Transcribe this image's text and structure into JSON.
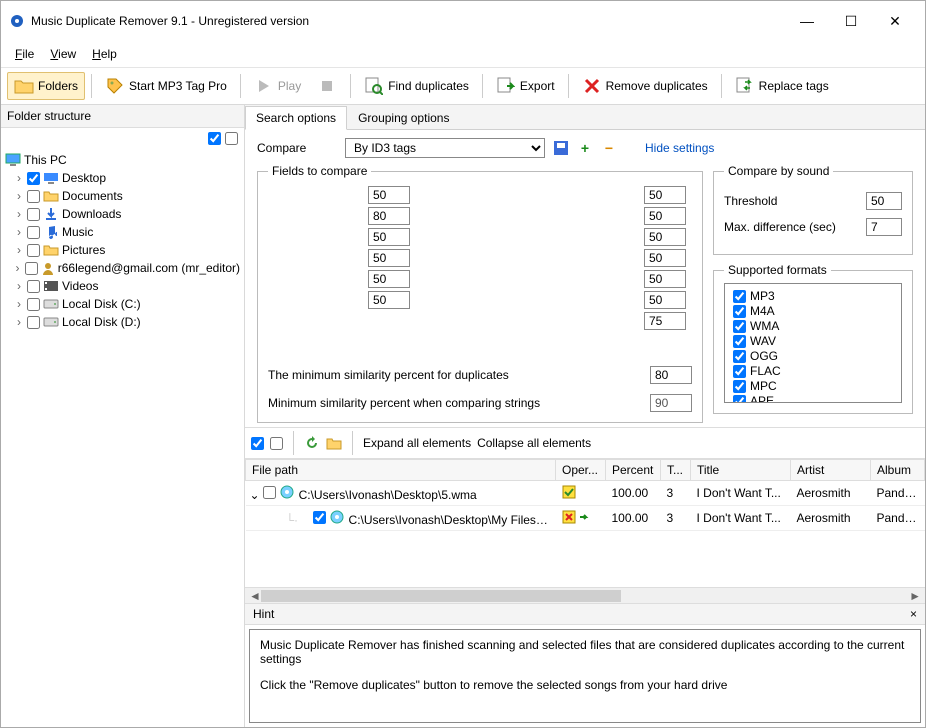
{
  "window": {
    "title": "Music Duplicate Remover 9.1 - Unregistered version"
  },
  "menu": {
    "file": "File",
    "view": "View",
    "help": "Help"
  },
  "toolbar": {
    "folders": "Folders",
    "start_tag": "Start MP3 Tag Pro",
    "play": "Play",
    "find_dup": "Find duplicates",
    "export": "Export",
    "remove_dup": "Remove duplicates",
    "replace_tags": "Replace tags"
  },
  "left": {
    "title": "Folder structure",
    "root": "This PC",
    "items": [
      {
        "label": "Desktop",
        "checked": true,
        "icon": "desktop"
      },
      {
        "label": "Documents",
        "checked": false,
        "icon": "folder"
      },
      {
        "label": "Downloads",
        "checked": false,
        "icon": "download"
      },
      {
        "label": "Music",
        "checked": false,
        "icon": "music"
      },
      {
        "label": "Pictures",
        "checked": false,
        "icon": "folder"
      },
      {
        "label": "r66legend@gmail.com (mr_editor)",
        "checked": false,
        "icon": "user"
      },
      {
        "label": "Videos",
        "checked": false,
        "icon": "video"
      },
      {
        "label": "Local Disk (C:)",
        "checked": false,
        "icon": "disk"
      },
      {
        "label": "Local Disk (D:)",
        "checked": false,
        "icon": "disk"
      }
    ]
  },
  "tabs": {
    "search": "Search options",
    "grouping": "Grouping options"
  },
  "compare": {
    "label": "Compare",
    "value": "By ID3 tags",
    "hide": "Hide settings"
  },
  "fields": {
    "legend": "Fields to compare",
    "left": [
      "50",
      "80",
      "50",
      "50",
      "50",
      "50"
    ],
    "right": [
      "50",
      "50",
      "50",
      "50",
      "50",
      "50",
      "75"
    ],
    "min_dup_label": "The minimum similarity percent for duplicates",
    "min_dup_value": "80",
    "min_str_label": "Minimum similarity percent when comparing strings",
    "min_str_value": "90"
  },
  "sound": {
    "legend": "Compare by sound",
    "threshold_label": "Threshold",
    "threshold_value": "50",
    "maxdiff_label": "Max. difference (sec)",
    "maxdiff_value": "7"
  },
  "formats": {
    "legend": "Supported formats",
    "items": [
      "MP3",
      "M4A",
      "WMA",
      "WAV",
      "OGG",
      "FLAC",
      "MPC",
      "APE"
    ]
  },
  "dup_toolbar": {
    "expand": "Expand all elements",
    "collapse": "Collapse all elements"
  },
  "grid": {
    "headers": {
      "file": "File path",
      "oper": "Oper...",
      "percent": "Percent",
      "t": "T...",
      "title": "Title",
      "artist": "Artist",
      "album": "Album"
    },
    "rows": [
      {
        "checked": false,
        "path": "C:\\Users\\Ivonash\\Desktop\\5.wma",
        "percent": "100.00",
        "t": "3",
        "title": "I Don't Want T...",
        "artist": "Aerosmith",
        "album": "Pandora's ...",
        "op": "ok",
        "indent": 0
      },
      {
        "checked": true,
        "path": "C:\\Users\\Ivonash\\Desktop\\My Files\\Inpu...",
        "percent": "100.00",
        "t": "3",
        "title": "I Don't Want T...",
        "artist": "Aerosmith",
        "album": "Pandora's ...",
        "op": "del",
        "indent": 1
      }
    ]
  },
  "hint": {
    "label": "Hint",
    "line1": "Music Duplicate Remover has finished scanning and selected files that are considered duplicates according to the current settings",
    "line2": "Click the \"Remove duplicates\" button to remove the selected songs from your hard drive"
  }
}
